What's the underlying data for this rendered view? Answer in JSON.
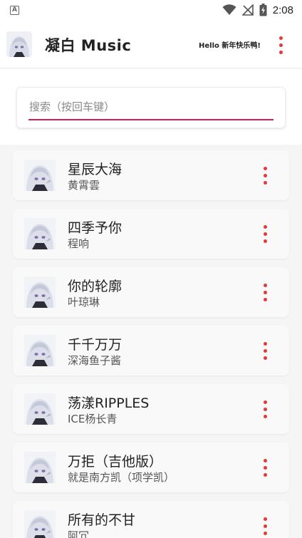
{
  "status_bar": {
    "notification_icon": "A",
    "time": "2:08",
    "icons": [
      "wifi-icon",
      "no-signal-icon",
      "battery-charging-icon"
    ]
  },
  "app_bar": {
    "title": "凝白 Music",
    "greeting": "Hello 新年快乐鸭!",
    "menu_icon": "more-vertical-icon",
    "accent_color": "#e53935"
  },
  "search": {
    "placeholder": "搜索（按回车键）",
    "value": "",
    "underline_color": "#d81b60"
  },
  "songs": [
    {
      "title": "星辰大海",
      "artist": "黄霄雲"
    },
    {
      "title": "四季予你",
      "artist": "程响"
    },
    {
      "title": "你的轮廓",
      "artist": "叶琼琳"
    },
    {
      "title": "千千万万",
      "artist": "深海鱼子酱"
    },
    {
      "title": "荡漾RIPPLES",
      "artist": "ICE杨长青"
    },
    {
      "title": "万拒（吉他版）",
      "artist": "就是南方凯（项学凯）"
    },
    {
      "title": "所有的不甘",
      "artist": "阿冗"
    }
  ]
}
